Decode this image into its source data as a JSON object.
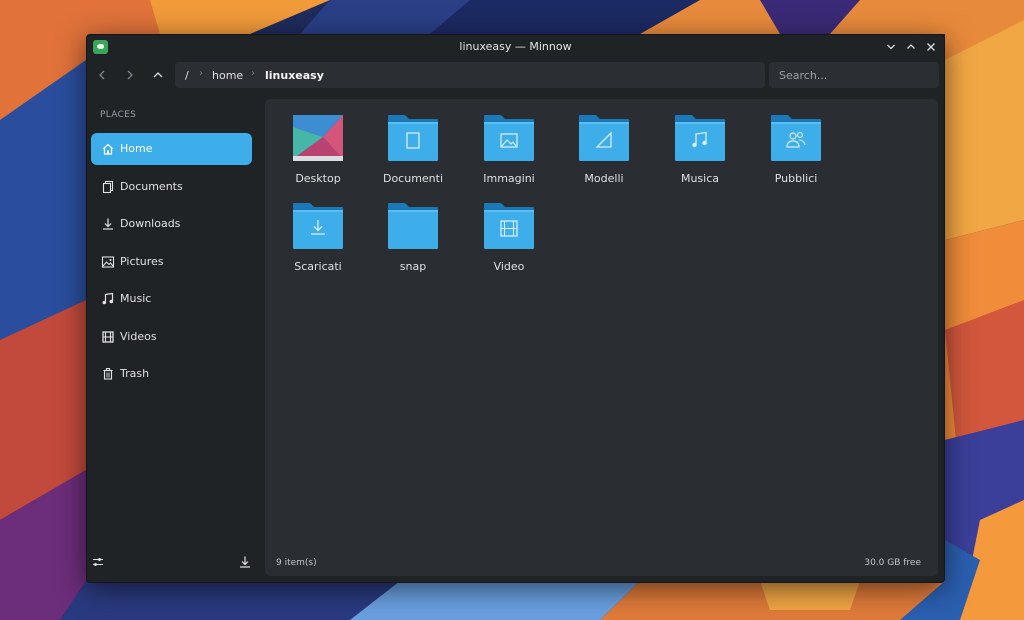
{
  "window": {
    "title": "linuxeasy — Minnow"
  },
  "toolbar": {
    "breadcrumb": [
      "/",
      "home",
      "linuxeasy"
    ],
    "search_placeholder": "Search..."
  },
  "sidebar": {
    "heading": "PLACES",
    "items": [
      {
        "label": "Home",
        "icon": "home-icon",
        "active": true
      },
      {
        "label": "Documents",
        "icon": "document-icon"
      },
      {
        "label": "Downloads",
        "icon": "download-icon"
      },
      {
        "label": "Pictures",
        "icon": "picture-icon"
      },
      {
        "label": "Music",
        "icon": "music-note-icon"
      },
      {
        "label": "Videos",
        "icon": "film-icon"
      },
      {
        "label": "Trash",
        "icon": "trash-icon"
      }
    ]
  },
  "files": [
    {
      "name": "Desktop",
      "icon": "desktop-thumbnail"
    },
    {
      "name": "Documenti",
      "icon": "folder-documents-icon"
    },
    {
      "name": "Immagini",
      "icon": "folder-pictures-icon"
    },
    {
      "name": "Modelli",
      "icon": "folder-templates-icon"
    },
    {
      "name": "Musica",
      "icon": "folder-music-icon"
    },
    {
      "name": "Pubblici",
      "icon": "folder-public-icon"
    },
    {
      "name": "Scaricati",
      "icon": "folder-download-icon"
    },
    {
      "name": "snap",
      "icon": "folder-icon"
    },
    {
      "name": "Video",
      "icon": "folder-videos-icon"
    }
  ],
  "status": {
    "items": "9 item(s)",
    "free": "30.0 GB free"
  },
  "colors": {
    "accent": "#3daee9",
    "folder": "#3daee9",
    "window_bg": "#202326",
    "content_bg": "#2a2e32"
  }
}
